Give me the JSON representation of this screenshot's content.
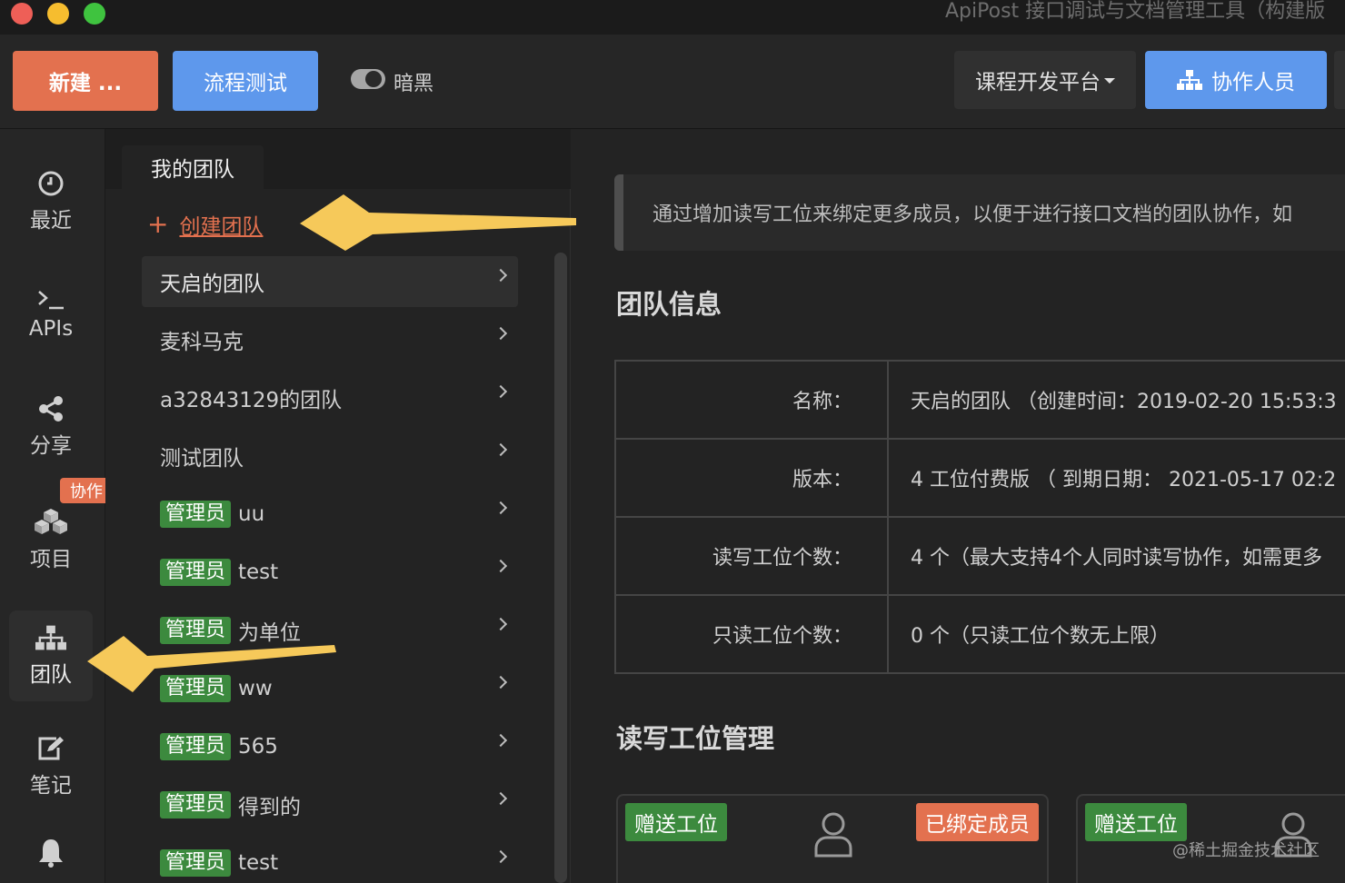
{
  "window": {
    "title": "ApiPost 接口调试与文档管理工具（构建版"
  },
  "toolbar": {
    "new_label": "新建 ...",
    "flow_label": "流程测试",
    "dark_label": "暗黑",
    "platform_label": "课程开发平台",
    "collab_label": "协作人员"
  },
  "nav": {
    "recent": "最近",
    "apis": "APIs",
    "share": "分享",
    "project": "项目",
    "team": "团队",
    "team_badge": "协作",
    "notes": "笔记"
  },
  "team_panel": {
    "tab_label": "我的团队",
    "create_label": "创建团队",
    "items": [
      {
        "name": "天启的团队",
        "admin": ""
      },
      {
        "name": "麦科马克",
        "admin": ""
      },
      {
        "name": "a32843129的团队",
        "admin": ""
      },
      {
        "name": "测试团队",
        "admin": ""
      },
      {
        "name": "uu",
        "admin": "管理员"
      },
      {
        "name": "test",
        "admin": "管理员"
      },
      {
        "name": "为单位",
        "admin": "管理员"
      },
      {
        "name": "ww",
        "admin": "管理员"
      },
      {
        "name": "565",
        "admin": "管理员"
      },
      {
        "name": "得到的",
        "admin": "管理员"
      },
      {
        "name": "test",
        "admin": "管理员"
      }
    ]
  },
  "main": {
    "notice": "通过增加读写工位来绑定更多成员，以便于进行接口文档的团队协作，如",
    "info_title": "团队信息",
    "info_rows": [
      {
        "key": "名称：",
        "value": "天启的团队 （创建时间：2019-02-20 15:53:3"
      },
      {
        "key": "版本：",
        "value": "4 工位付费版 （ 到期日期： 2021-05-17 02:2"
      },
      {
        "key": "读写工位个数：",
        "value": "4 个（最大支持4个人同时读写协作，如需更多"
      },
      {
        "key": "只读工位个数：",
        "value": "0 个（只读工位个数无上限）"
      }
    ],
    "seat_title": "读写工位管理",
    "seat_tag": "赠送工位",
    "bound_tag": "已绑定成员"
  },
  "watermark": "@稀土掘金技术社区",
  "colors": {
    "accent_orange": "#e3714f",
    "accent_blue": "#5e98ec",
    "admin_green": "#3c8a3e",
    "arrow_yellow": "#f6c95a"
  }
}
